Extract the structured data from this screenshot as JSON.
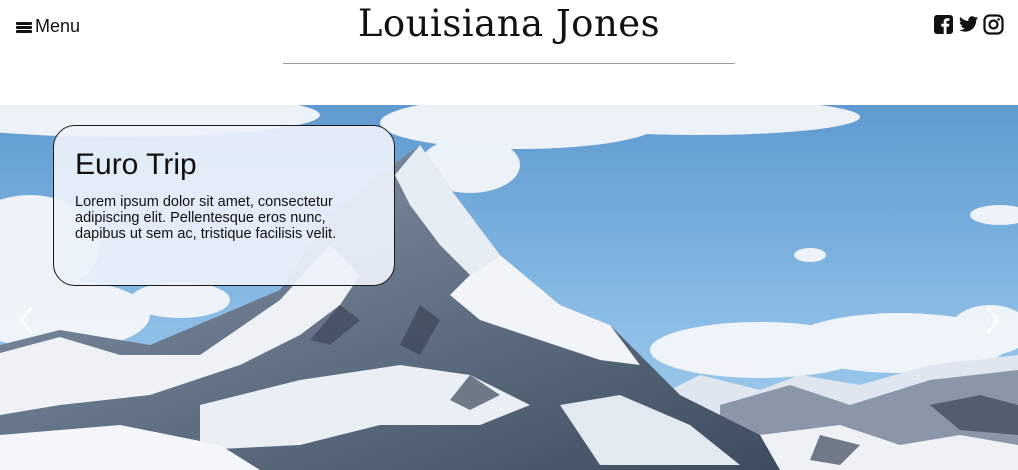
{
  "header": {
    "menu_label": "Menu",
    "title": "Louisiana Jones",
    "social_icons": [
      "facebook-icon",
      "twitter-icon",
      "instagram-icon"
    ]
  },
  "carousel": {
    "slide": {
      "title": "Euro Trip",
      "text": "Lorem ipsum dolor sit amet, consectetur adipiscing elit. Pellentesque eros nunc, dapibus ut sem ac, tristique facilisis velit."
    },
    "prev_icon": "chevron-left-icon",
    "next_icon": "chevron-right-icon"
  },
  "colors": {
    "sky": "#6fa8d8",
    "snow": "#f2f5f9",
    "rock": "#4a5a70",
    "caption_bg": "#ecf1fa"
  }
}
